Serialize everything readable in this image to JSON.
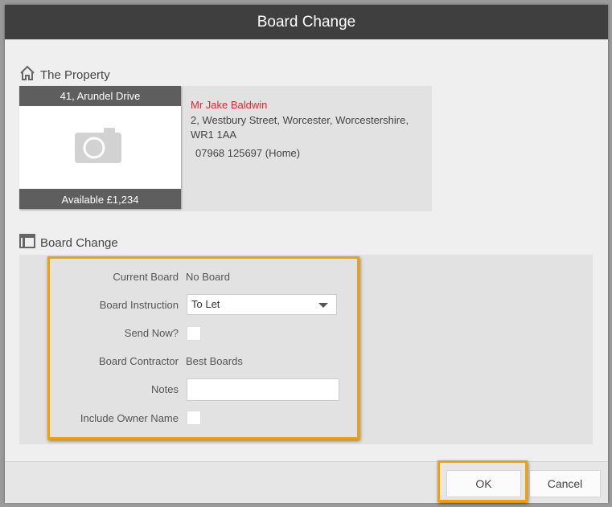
{
  "dialog": {
    "title": "Board Change"
  },
  "property_section": {
    "heading": "The Property",
    "address_title": "41, Arundel Drive",
    "availability": "Available £1,234",
    "owner_name": "Mr Jake Baldwin",
    "owner_address": "2, Westbury Street, Worcester, Worcestershire, WR1 1AA",
    "owner_phone": "07968 125697 (Home)"
  },
  "board_section": {
    "heading": "Board Change",
    "current_board": {
      "label": "Current Board",
      "value": "No Board"
    },
    "board_instruction": {
      "label": "Board Instruction",
      "value": "To Let"
    },
    "send_now": {
      "label": "Send Now?",
      "checked": false
    },
    "board_contractor": {
      "label": "Board Contractor",
      "value": "Best Boards"
    },
    "notes": {
      "label": "Notes",
      "value": ""
    },
    "include_owner_name": {
      "label": "Include Owner Name",
      "checked": false
    }
  },
  "footer": {
    "ok_label": "OK",
    "cancel_label": "Cancel"
  },
  "colors": {
    "titlebar": "#3f3f3f",
    "highlight": "#f4a000",
    "owner_name": "#d9282f"
  },
  "icons": [
    "home-icon",
    "camera-icon",
    "board-icon",
    "chevron-down-icon"
  ]
}
